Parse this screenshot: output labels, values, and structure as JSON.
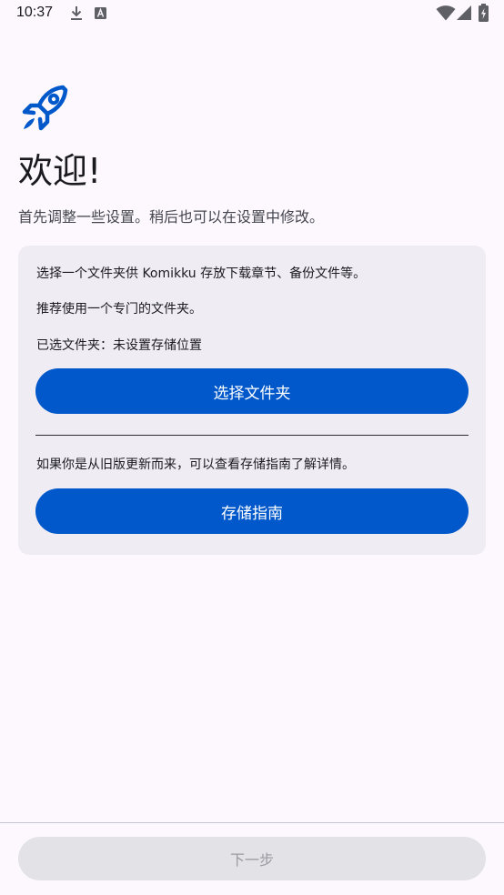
{
  "status_bar": {
    "time": "10:37",
    "icons": [
      "download-icon",
      "keyboard-a-icon",
      "wifi-icon",
      "signal-icon",
      "battery-charging-icon"
    ]
  },
  "header": {
    "icon": "rocket-icon",
    "title": "欢迎!",
    "subtitle": "首先调整一些设置。稍后也可以在设置中修改。"
  },
  "storage_card": {
    "description": "选择一个文件夹供 Komikku 存放下载章节、备份文件等。",
    "recommendation": "推荐使用一个专门的文件夹。",
    "selected_folder": "已选文件夹：未设置存储位置",
    "choose_folder_label": "选择文件夹",
    "upgrade_hint": "如果你是从旧版更新而来，可以查看存储指南了解详情。",
    "storage_guide_label": "存储指南"
  },
  "footer": {
    "next_label": "下一步"
  },
  "colors": {
    "background": "#fcf8fd",
    "accent": "#0058ca",
    "card": "#efecf4",
    "disabled_button": "#e3e2e6",
    "disabled_text": "#9a9aa0"
  }
}
